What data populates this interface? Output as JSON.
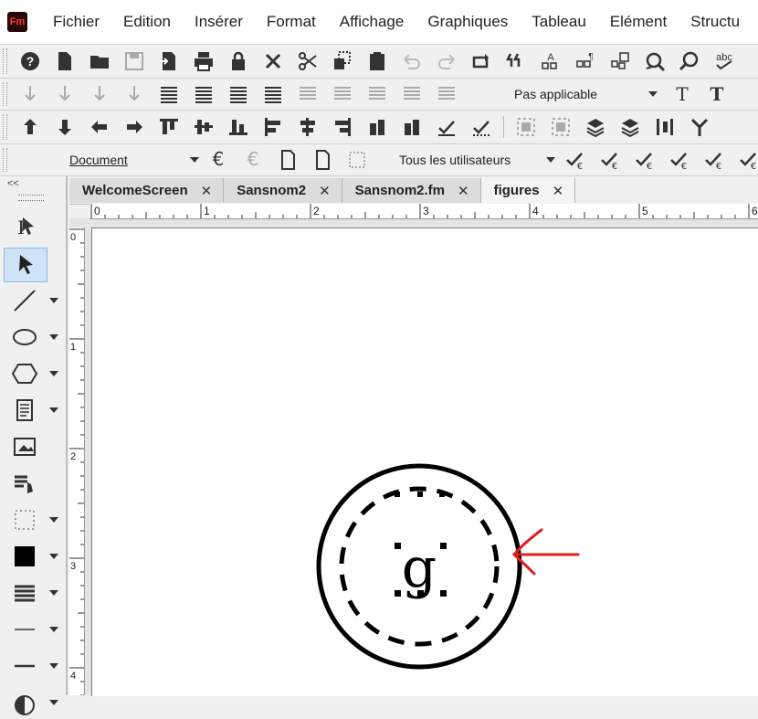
{
  "app": {
    "logo_text": "Fm"
  },
  "menu": [
    "Fichier",
    "Edition",
    "Insérer",
    "Format",
    "Affichage",
    "Graphiques",
    "Tableau",
    "Elément",
    "Structu"
  ],
  "toolbar": {
    "row1_icons": [
      "help-icon",
      "new-document-icon",
      "open-folder-icon",
      "save-icon",
      "import-icon",
      "print-icon",
      "lock-icon",
      "delete-icon",
      "cut-icon",
      "copy-icon",
      "paste-icon",
      "undo-icon",
      "redo-icon",
      "repeat-icon",
      "smart-quotes-icon",
      "spelling-icon",
      "paragraph-icon",
      "table-icon",
      "find-icon",
      "zoom-icon",
      "spellcheck-icon"
    ],
    "row2_icons": [
      "indent-1-icon",
      "indent-2-icon",
      "indent-3-icon",
      "indent-4-icon",
      "align-left-icon",
      "align-right-icon",
      "align-center-icon",
      "justify-icon",
      "line-spacing-1-icon",
      "line-spacing-2-icon",
      "line-spacing-3-icon",
      "line-spacing-4-icon",
      "line-spacing-5-icon"
    ],
    "row2_select": "Pas applicable",
    "row2_right_icons": [
      "text-t-icon",
      "text-t-bold-icon"
    ],
    "row3_icons": [
      "arrow-up-icon",
      "arrow-down-icon",
      "arrow-left-icon",
      "arrow-right-icon",
      "align-top-icon",
      "align-middle-icon",
      "align-bottom-icon",
      "align-left-obj-icon",
      "align-center-obj-icon",
      "align-right-obj-icon",
      "flip-left-icon",
      "flip-right-icon",
      "check-icon",
      "check-all-icon",
      "group-icon",
      "ungroup-icon",
      "layers-up-icon",
      "layers-down-icon",
      "distribute-icon",
      "branch-icon"
    ],
    "row4_select_doc": "Document",
    "row4_select_users": "Tous les utilisateurs",
    "row4_icons": [
      "conditional-icon",
      "conditional-locked-icon",
      "page-icon",
      "blank-page-icon",
      "frame-icon"
    ],
    "row4_right_icons": [
      "accept-change-icon",
      "reject-change-icon",
      "accept-all-icon",
      "reject-all-icon",
      "next-change-icon",
      "prev-change-icon"
    ]
  },
  "tools": [
    "text-select-tool-icon",
    "object-select-tool-icon",
    "line-tool-icon",
    "oval-tool-icon",
    "polygon-tool-icon",
    "text-frame-tool-icon",
    "graphic-frame-tool-icon",
    "hotspot-tool-icon",
    "frame-tool-icon",
    "fill-tool-icon",
    "line-width-tool-icon",
    "line-end-tool-icon",
    "dash-tool-icon",
    "tint-tool-icon"
  ],
  "tabs": [
    {
      "label": "WelcomeScreen",
      "active": false
    },
    {
      "label": "Sansnom2",
      "active": false
    },
    {
      "label": "Sansnom2.fm",
      "active": false
    },
    {
      "label": "figures",
      "active": true
    }
  ],
  "tab_close_glyph": "✕",
  "collapse_glyph": "<<",
  "ruler_top_labels": [
    "0",
    "1",
    "2",
    "3",
    "4",
    "5",
    "6"
  ],
  "ruler_left_labels": [
    "0",
    "1",
    "2",
    "3",
    "4"
  ],
  "canvas": {
    "glyph": "g"
  },
  "colors": {
    "annotation_arrow": "#e02020",
    "accent": "#e8272a"
  }
}
